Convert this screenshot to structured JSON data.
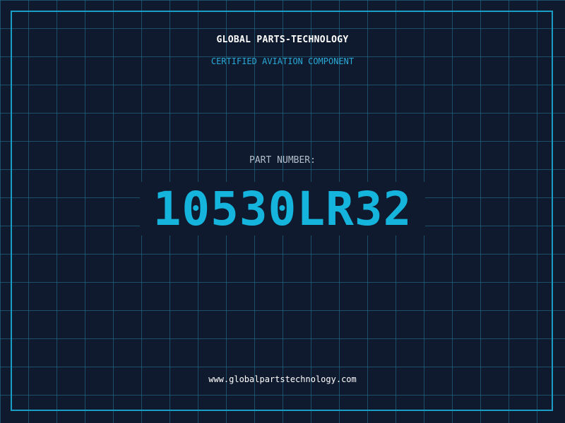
{
  "header": {
    "company": "GLOBAL PARTS-TECHNOLOGY",
    "subtitle": "CERTIFIED AVIATION COMPONENT"
  },
  "part": {
    "label": "PART NUMBER:",
    "number": "10530LR32"
  },
  "footer": {
    "website": "www.globalpartstechnology.com"
  },
  "colors": {
    "background": "#101a2e",
    "grid": "#287896",
    "frame": "#1b9ec4",
    "accent": "#15b4dd",
    "subtitle": "#29a9d6",
    "label": "#b3bfcc",
    "text": "#ffffff"
  }
}
